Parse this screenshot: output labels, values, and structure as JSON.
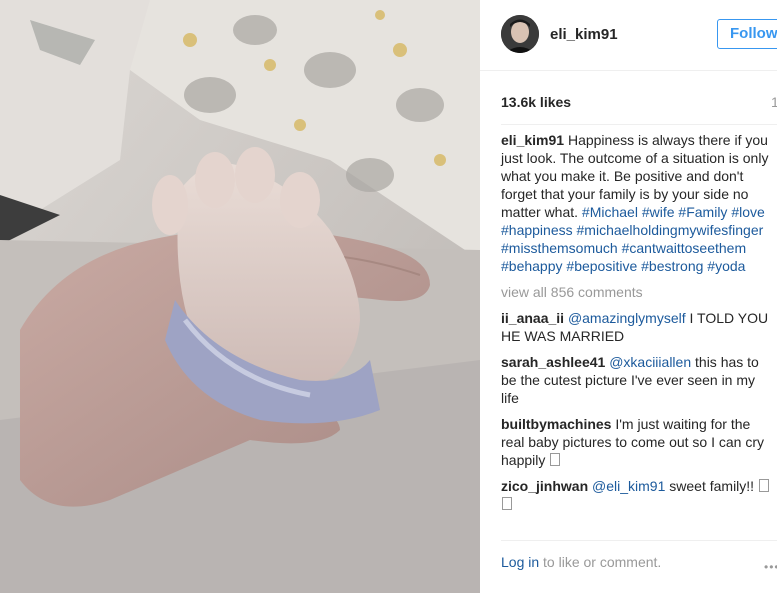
{
  "photo": {
    "alt": "baby hand holding finger"
  },
  "header": {
    "username": "eli_kim91",
    "follow_label": "Follow"
  },
  "likes": {
    "count_label": "13.6k likes",
    "time_label": "1"
  },
  "caption": {
    "user": "eli_kim91",
    "text": " Happiness is always there if you just look. The outcome of a situation is only what you make it. Be positive and don't forget that your family is by your side no matter what. ",
    "tags": [
      "#Michael",
      "#wife",
      "#Family",
      "#love",
      "#happiness",
      "#michaelholdingmywifesfinger",
      "#missthemsomuch",
      "#cantwaittoseethem",
      "#behappy",
      "#bepositive",
      "#bestrong",
      "#yoda"
    ]
  },
  "view_all": "view all 856 comments",
  "comments": [
    {
      "user": "ii_anaa_ii",
      "mention": "@amazinglymyself",
      "text": " I TOLD YOU HE WAS MARRIED"
    },
    {
      "user": "sarah_ashlee41",
      "mention": "@xkaciiiallen",
      "text": " this has to be the cutest picture I've ever seen in my life"
    },
    {
      "user": "builtbymachines",
      "mention": "",
      "text": " I'm just waiting for the real baby pictures to come out so I can cry happily "
    },
    {
      "user": "zico_jinhwan",
      "mention": "@eli_kim91",
      "text": " sweet family!! "
    }
  ],
  "footer": {
    "login_link": "Log in",
    "login_text": " to like or comment.",
    "more_icon": "more-horizontal-icon"
  }
}
